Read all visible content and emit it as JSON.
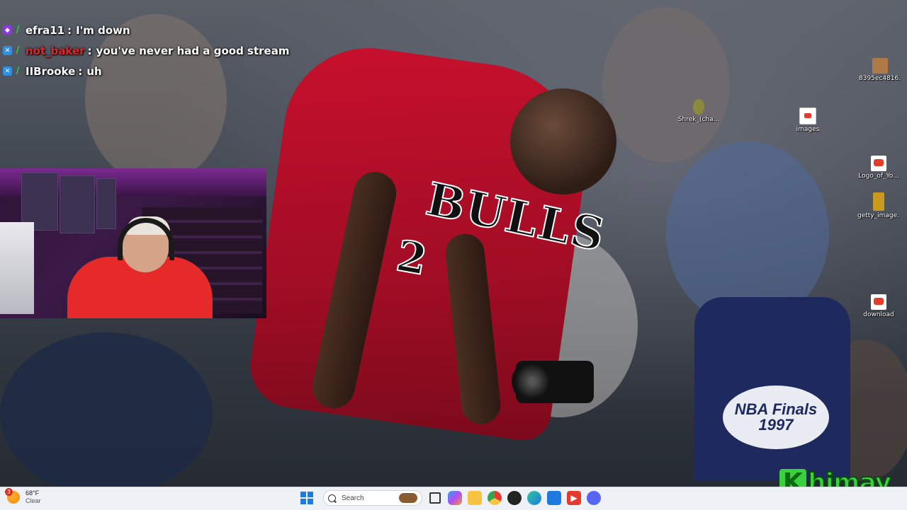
{
  "chat": {
    "messages": [
      {
        "user": "efra11",
        "text": "I'm down",
        "user_color": "#ffffff",
        "badges": [
          "sub-badge",
          "pen-badge"
        ]
      },
      {
        "user": "not_baker",
        "text": "you've never had a good stream",
        "user_color": "#e0242a",
        "badges": [
          "prime-badge",
          "pen-badge"
        ]
      },
      {
        "user": "IIBrooke",
        "text": "uh",
        "user_color": "#ffffff",
        "badges": [
          "prime-badge",
          "pen-badge"
        ]
      }
    ],
    "separator": ":"
  },
  "wallpaper": {
    "jersey_text": "BULLS",
    "jersey_number": "2",
    "finals_logo": "NBA Finals 1997"
  },
  "desktop_icons": [
    {
      "label": "8395ec4816...",
      "color": "#b07a48"
    },
    {
      "label": "Shrek_(cha...",
      "color": "#8b8a3c"
    },
    {
      "label": "images",
      "color": "#e33b2e"
    },
    {
      "label": "Logo_of_Yo...",
      "color": "#e33b2e"
    },
    {
      "label": "getty_image...",
      "color": "#c99a1b"
    },
    {
      "label": "download",
      "color": "#e33b2e"
    }
  ],
  "watermark": {
    "letter": "K",
    "name": "himay"
  },
  "taskbar": {
    "weather": {
      "badge": "3",
      "temp": "68°F",
      "condition": "Clear"
    },
    "search_placeholder": "Search",
    "apps": [
      "task-view",
      "copilot",
      "file-explorer",
      "chrome",
      "obs",
      "edge",
      "store",
      "youtube",
      "discord"
    ]
  }
}
